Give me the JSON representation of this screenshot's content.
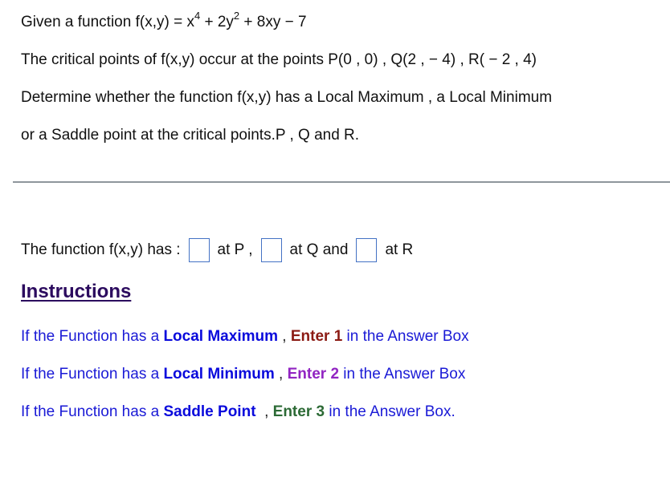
{
  "question": {
    "function_prefix": "Given a function f(x,y) = x",
    "exp1": "4",
    "mid1": " + 2y",
    "exp2": "2",
    "suffix": " + 8xy − 7",
    "critical_points": "The critical points of f(x,y) occur at the points P(0 , 0) , Q(2 , −  4) , R( − 2 , 4)",
    "determine_line1": "Determine whether the function  f(x,y) has a Local Maximum , a Local Minimum",
    "determine_line2": "or a Saddle point at the critical points.P ,  Q  and  R."
  },
  "answer": {
    "lead": "The function f(x,y) has :",
    "at_p": "at P ,",
    "at_q": "at  Q  and",
    "at_r": "at  R",
    "values": [
      "",
      "",
      ""
    ]
  },
  "instructions": {
    "title": "Instructions",
    "items": [
      {
        "pre": "If the Function has a ",
        "type": "Local Maximum",
        "sep": " , ",
        "enter": "Enter 1",
        "post": " in the Answer Box",
        "enter_color": "#8b1a13"
      },
      {
        "pre": "If the Function has a ",
        "type": "Local Minimum",
        "sep": " , ",
        "enter": "Enter 2",
        "post": " in the Answer Box",
        "enter_color": "#9124c2"
      },
      {
        "pre": "If the Function has a ",
        "type": "Saddle Point",
        "sep": "  , ",
        "enter": "Enter 3",
        "post": " in the Answer Box.",
        "enter_color": "#2c6a35"
      }
    ]
  },
  "colors": {
    "instruction_text": "#1a1ad6",
    "instruction_title": "#2b0a5e",
    "input_border": "#4472c4",
    "divider": "#8e969c"
  }
}
